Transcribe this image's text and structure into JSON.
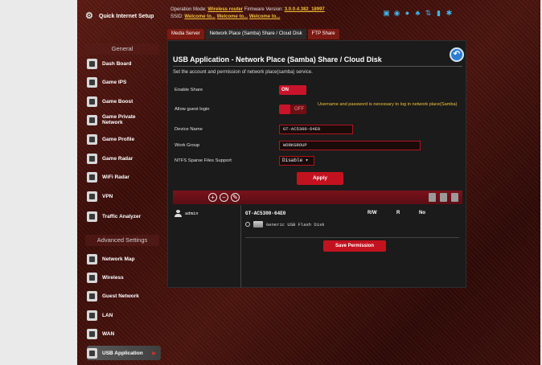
{
  "header": {
    "op_mode_label": "Operation Mode:",
    "op_mode_value": "Wireless router",
    "fw_label": "Firmware Version:",
    "fw_value": "3.0.0.4.382_18997",
    "ssid_label": "SSID:",
    "ssid_values": [
      "Welcome to...",
      "Welcome to...",
      "Welcome to..."
    ]
  },
  "sidebar": {
    "quick_setup": "Quick Internet Setup",
    "general_label": "General",
    "general_items": [
      {
        "label": "Dash Board",
        "icon": "dashboard-icon"
      },
      {
        "label": "Game IPS",
        "icon": "shield-icon"
      },
      {
        "label": "Game Boost",
        "icon": "rocket-icon"
      },
      {
        "label": "Game Private\nNetwork",
        "icon": "private-network-icon"
      },
      {
        "label": "Game Profile",
        "icon": "profile-icon"
      },
      {
        "label": "Game Radar",
        "icon": "radar-icon"
      },
      {
        "label": "WiFi Radar",
        "icon": "wifi-radar-icon"
      },
      {
        "label": "VPN",
        "icon": "vpn-icon"
      },
      {
        "label": "Traffic Analyzer",
        "icon": "traffic-icon"
      }
    ],
    "advanced_label": "Advanced Settings",
    "advanced_items": [
      {
        "label": "Network Map",
        "icon": "network-map-icon"
      },
      {
        "label": "Wireless",
        "icon": "wireless-icon"
      },
      {
        "label": "Guest Network",
        "icon": "guest-icon"
      },
      {
        "label": "LAN",
        "icon": "lan-icon"
      },
      {
        "label": "WAN",
        "icon": "wan-icon"
      },
      {
        "label": "USB Application",
        "icon": "usb-icon"
      }
    ]
  },
  "tabs": [
    "Media Server",
    "Network Place (Samba) Share / Cloud Disk",
    "FTP Share"
  ],
  "panel": {
    "title": "USB Application - Network Place (Samba) Share / Cloud Disk",
    "description": "Set the account and permission of network place(samba) service.",
    "enable_share_label": "Enable Share",
    "enable_share_state": "ON",
    "guest_login_label": "Allow guest login",
    "guest_login_state": "OFF",
    "guest_hint": "Username and password is necessary to log in network place(Samba)",
    "device_name_label": "Device Name",
    "device_name_value": "GT-AC5300-64E0",
    "work_group_label": "Work Group",
    "work_group_value": "WORKGROUP",
    "ntfs_label": "NTFS Sparse Files Support",
    "ntfs_value": "Disable ▾",
    "apply_label": "Apply"
  },
  "share_table": {
    "user": "admin",
    "device": "GT-AC5300-64E0",
    "col_rw": "R/W",
    "col_r": "R",
    "col_no": "No",
    "disk": "Generic USB Flash Disk",
    "save_label": "Save Permission"
  }
}
